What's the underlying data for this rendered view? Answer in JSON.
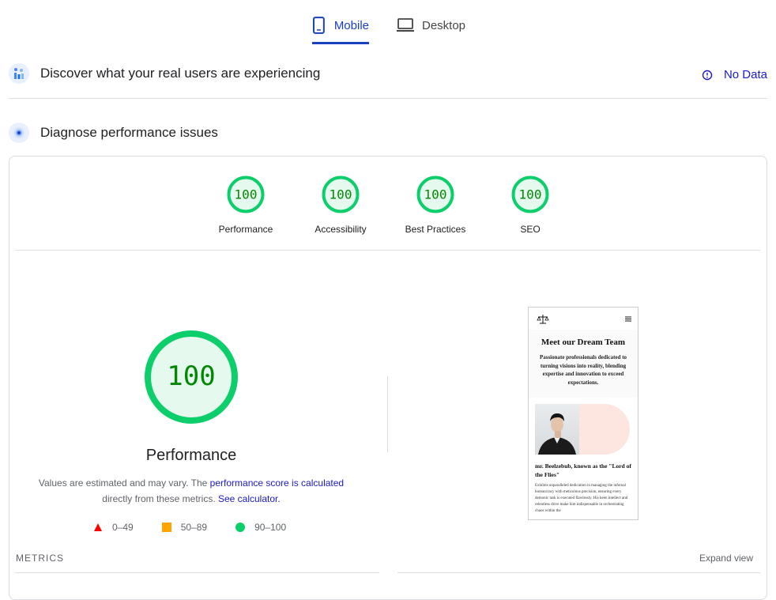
{
  "tabs": {
    "mobile": "Mobile",
    "desktop": "Desktop"
  },
  "field_data": {
    "title": "Discover what your real users are experiencing",
    "status": "No Data"
  },
  "lab": {
    "title": "Diagnose performance issues"
  },
  "scores": [
    {
      "label": "Performance",
      "value": "100"
    },
    {
      "label": "Accessibility",
      "value": "100"
    },
    {
      "label": "Best Practices",
      "value": "100"
    },
    {
      "label": "SEO",
      "value": "100"
    }
  ],
  "perf": {
    "score": "100",
    "title": "Performance",
    "desc_1": "Values are estimated and may vary. The ",
    "link_1": "performance score is calculated",
    "desc_2": "directly from these metrics. ",
    "link_2": "See calculator."
  },
  "legend": {
    "fail": "0–49",
    "average": "50–89",
    "pass": "90–100"
  },
  "metrics": {
    "label": "METRICS",
    "expand": "Expand view"
  },
  "phone": {
    "title": "Meet our Dream Team",
    "subtitle": "Passionate professionals dedicated to turning visions into reality, blending expertise and innovation to exceed expectations.",
    "member_name": "mr. Beelzebub, known as the \"Lord of the Flies\"",
    "member_bio": "Exhibits unparalleled dedication in managing the infernal bureaucracy with meticulous precision, ensuring every demonic task is executed flawlessly. His keen intellect and relentless drive make him indispensable in orchestrating chaos within the"
  },
  "colors": {
    "accent": "#1a3fc1",
    "pass": "#0cce6b",
    "pass_bg": "#e6f9ee",
    "pass_text": "#008800",
    "fail": "#ff0000",
    "average": "#ffa400"
  }
}
